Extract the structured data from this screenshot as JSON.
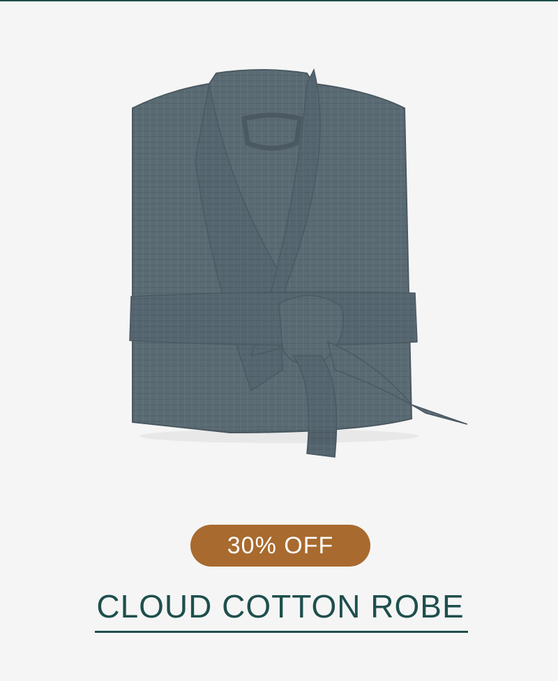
{
  "product": {
    "image_alt": "Folded gray waffle cotton robe with tied belt",
    "badge": "30% OFF",
    "title": "CLOUD COTTON ROBE"
  },
  "colors": {
    "background": "#f5f5f5",
    "accent_teal": "#1e4f4c",
    "badge_bg": "#a86a2e",
    "robe": "#5a6a73"
  }
}
